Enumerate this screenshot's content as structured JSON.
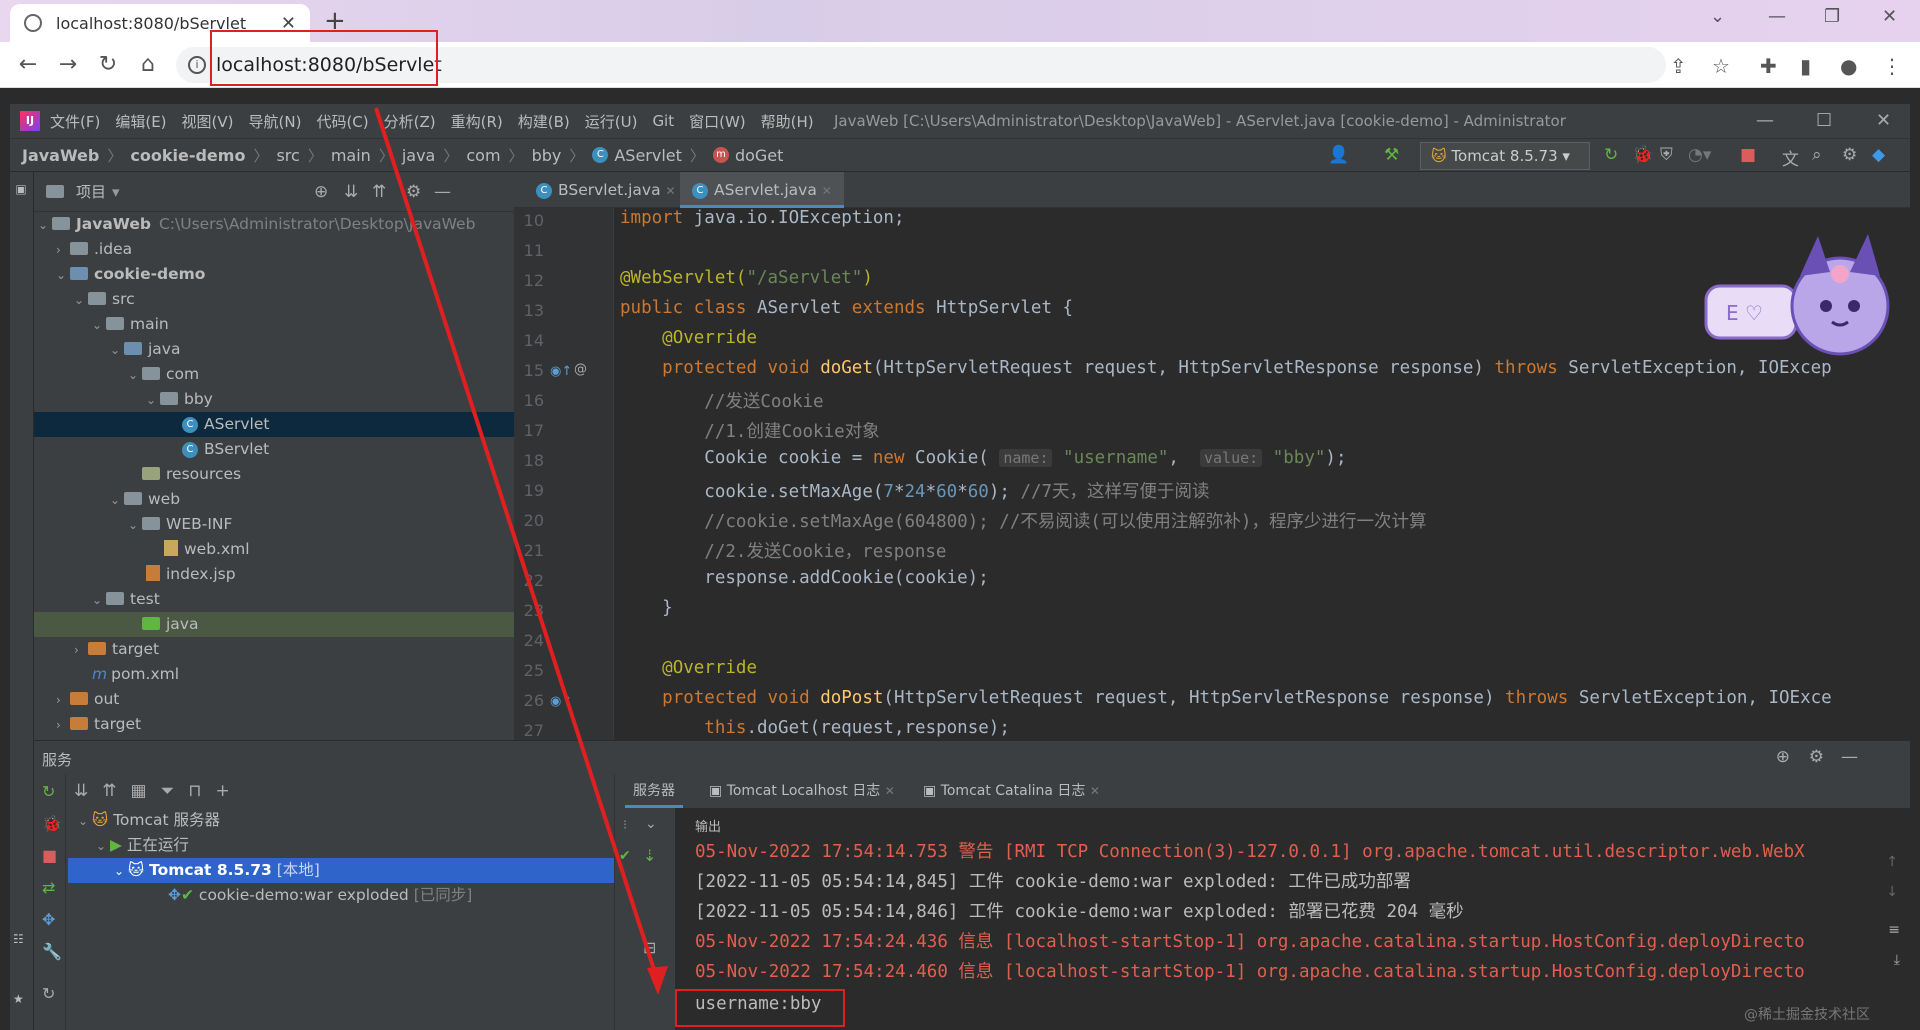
{
  "browser": {
    "tab_title": "localhost:8080/bServlet",
    "new_tab": "+",
    "url": "localhost:8080/bServlet"
  },
  "ide": {
    "menu": [
      "文件(F)",
      "编辑(E)",
      "视图(V)",
      "导航(N)",
      "代码(C)",
      "分析(Z)",
      "重构(R)",
      "构建(B)",
      "运行(U)",
      "Git",
      "窗口(W)",
      "帮助(H)"
    ],
    "title": "JavaWeb [C:\\Users\\Administrator\\Desktop\\JavaWeb] - AServlet.java [cookie-demo] - Administrator",
    "breadcrumb": [
      "JavaWeb",
      "cookie-demo",
      "src",
      "main",
      "java",
      "com",
      "bby",
      "AServlet",
      "doGet"
    ],
    "run_config": "Tomcat 8.5.73"
  },
  "project": {
    "header": "项目",
    "tree": [
      {
        "label": "JavaWeb",
        "extra": "C:\\Users\\Administrator\\Desktop\\JavaWeb"
      },
      {
        "label": ".idea"
      },
      {
        "label": "cookie-demo"
      },
      {
        "label": "src"
      },
      {
        "label": "main"
      },
      {
        "label": "java"
      },
      {
        "label": "com"
      },
      {
        "label": "bby"
      },
      {
        "label": "AServlet"
      },
      {
        "label": "BServlet"
      },
      {
        "label": "resources"
      },
      {
        "label": "web"
      },
      {
        "label": "WEB-INF"
      },
      {
        "label": "web.xml"
      },
      {
        "label": "index.jsp"
      },
      {
        "label": "test"
      },
      {
        "label": "java"
      },
      {
        "label": "target"
      },
      {
        "label": "pom.xml"
      },
      {
        "label": "out"
      },
      {
        "label": "target"
      }
    ]
  },
  "editor": {
    "tabs": [
      "BServlet.java",
      "AServlet.java"
    ],
    "line_numbers": [
      "10",
      "11",
      "12",
      "13",
      "14",
      "15",
      "16",
      "17",
      "18",
      "19",
      "20",
      "21",
      "22",
      "23",
      "24",
      "25",
      "26",
      "27"
    ]
  },
  "services": {
    "header": "服务",
    "tree": [
      "Tomcat 服务器",
      "正在运行",
      "Tomcat 8.5.73",
      "[本地]",
      "cookie-demo:war exploded",
      "[已同步]"
    ],
    "tabs": [
      "服务器",
      "Tomcat Localhost 日志",
      "Tomcat Catalina 日志"
    ],
    "output_label": "输出",
    "log": [
      "05-Nov-2022 17:54:14.753 警告 [RMI TCP Connection(3)-127.0.0.1] org.apache.tomcat.util.descriptor.web.WebX",
      "[2022-11-05 05:54:14,845] 工件 cookie-demo:war exploded: 工件已成功部署",
      "[2022-11-05 05:54:14,846] 工件 cookie-demo:war exploded: 部署已花费 204 毫秒",
      "05-Nov-2022 17:54:24.436 信息 [localhost-startStop-1] org.apache.catalina.startup.HostConfig.deployDirecto",
      "05-Nov-2022 17:54:24.460 信息 [localhost-startStop-1] org.apache.catalina.startup.HostConfig.deployDirecto",
      "username:bby"
    ],
    "watermark": "@稀土掘金技术社区"
  }
}
